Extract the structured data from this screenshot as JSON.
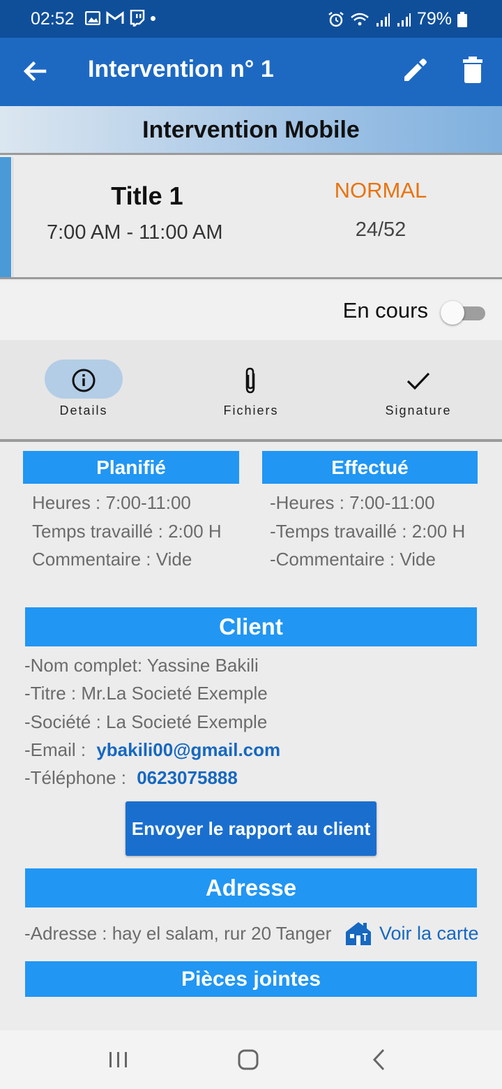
{
  "status_bar": {
    "time": "02:52",
    "battery": "79%",
    "notif_icons": [
      "image-icon",
      "gmail-icon",
      "twitch-icon",
      "dot-icon"
    ],
    "system_icons": [
      "alarm-icon",
      "wifi-icon",
      "signal-icon",
      "signal-icon",
      "battery-icon"
    ]
  },
  "appbar": {
    "title": "Intervention n° 1",
    "icons": [
      "back-arrow-icon",
      "edit-icon",
      "delete-icon"
    ]
  },
  "header": {
    "title": "Intervention Mobile"
  },
  "card": {
    "title": "Title 1",
    "time_range": "7:00 AM - 11:00 AM",
    "priority": "NORMAL",
    "counter": "24/52",
    "accent_color": "#4a9ad8",
    "priority_color": "#e8730e"
  },
  "status": {
    "label": "En cours",
    "toggle_on": false
  },
  "tabs": [
    {
      "label": "Details",
      "icon": "info-icon",
      "active": true
    },
    {
      "label": "Fichiers",
      "icon": "paperclip-icon",
      "active": false
    },
    {
      "label": "Signature",
      "icon": "check-icon",
      "active": false
    }
  ],
  "planifie": {
    "header": "Planifié",
    "heures": "Heures : 7:00-11:00",
    "temps": "Temps travaillé : 2:00 H",
    "commentaire": "Commentaire : Vide"
  },
  "effectue": {
    "header": "Effectué",
    "heures": "-Heures : 7:00-11:00",
    "temps": "-Temps travaillé : 2:00 H",
    "commentaire": "-Commentaire : Vide"
  },
  "client": {
    "header": "Client",
    "nom": "-Nom complet: Yassine Bakili",
    "titre": "-Titre : Mr.La Societé Exemple",
    "societe": "-Société : La Societé Exemple",
    "email_label": "-Email : ",
    "email": "ybakili00@gmail.com",
    "telephone_label": "-Téléphone : ",
    "telephone": "0623075888",
    "send_button": "Envoyer le rapport au client"
  },
  "adresse": {
    "header": "Adresse",
    "text": "-Adresse : hay el salam, rur 20 Tanger",
    "map_link": "Voir la carte",
    "map_icon": "map-house-icon"
  },
  "pieces": {
    "header": "Pièces jointes"
  },
  "colors": {
    "status_bar": "#0f4f9a",
    "app_bar": "#1d69c2",
    "section_header": "#2196f3",
    "link": "#1668c0"
  },
  "navbar": {
    "icons": [
      "recent-apps-icon",
      "home-icon",
      "back-icon"
    ]
  }
}
